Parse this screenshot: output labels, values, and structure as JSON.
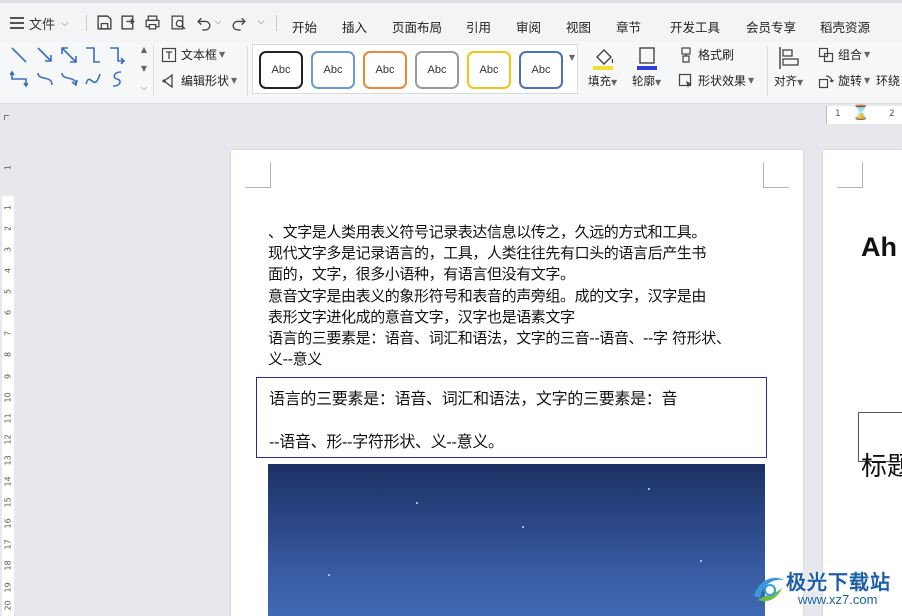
{
  "menubar": {
    "file_label": "文件",
    "tabs": [
      "开始",
      "插入",
      "页面布局",
      "引用",
      "审阅",
      "视图",
      "章节",
      "开发工具",
      "会员专享",
      "稻壳资源"
    ]
  },
  "ribbon": {
    "textbox_label": "文本框",
    "edit_shape_label": "编辑形状",
    "style_samples": [
      "Abc",
      "Abc",
      "Abc",
      "Abc",
      "Abc",
      "Abc"
    ],
    "fill_label": "填充",
    "outline_label": "轮廓",
    "format_painter_label": "格式刷",
    "shape_effect_label": "形状效果",
    "align_label": "对齐",
    "group_label": "组合",
    "rotate_label": "旋转",
    "wrap_label": "环绕"
  },
  "ruler": {
    "h_numbers": [
      "1",
      "2"
    ],
    "v_numbers": [
      "1",
      "1",
      "2",
      "3",
      "4",
      "5",
      "6",
      "7",
      "8",
      "9",
      "10",
      "11",
      "12",
      "13",
      "14",
      "15",
      "16",
      "17",
      "18",
      "19",
      "20"
    ]
  },
  "document": {
    "lines": [
      "、文字是人类用表义符号记录表达信息以传之，久远的方式和工具。",
      "现代文字多是记录语言的，工具，人类往往先有口头的语言后产生书",
      "面的，文字，很多小语种，有语言但没有文字。",
      "意音文字是由表义的象形符号和表音的声旁组。成的文字，汉字是由",
      "表形文字进化成的意音文字，汉字也是语素文字",
      "语言的三要素是：语音、词汇和语法，文字的三音--语音、--字  符形状、",
      "义--意义"
    ],
    "textbox_lines": [
      "语言的三要素是：语音、词汇和语法，文字的三要素是：音",
      "--语音、形--字符形状、义--意义。"
    ]
  },
  "page2": {
    "heading": "Ah",
    "title": "标题"
  },
  "watermark": {
    "name": "极光下载站",
    "url": "www.xz7.com"
  }
}
